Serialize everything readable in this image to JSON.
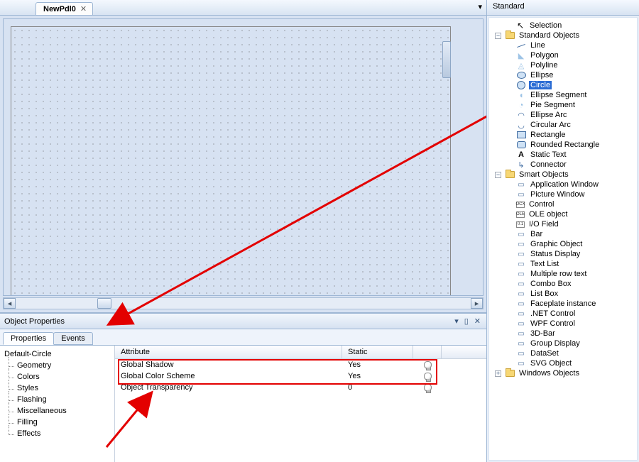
{
  "canvas_tab": "NewPdl0",
  "panel_title": "Object Properties",
  "tabs": {
    "properties": "Properties",
    "events": "Events"
  },
  "categories": {
    "root": "Default-Circle",
    "children": [
      "Geometry",
      "Colors",
      "Styles",
      "Flashing",
      "Miscellaneous",
      "Filling",
      "Effects"
    ]
  },
  "attr_headers": {
    "attribute": "Attribute",
    "static": "Static"
  },
  "attributes": [
    {
      "name": "Global Shadow",
      "static": "Yes"
    },
    {
      "name": "Global Color Scheme",
      "static": "Yes"
    },
    {
      "name": "Object Transparency",
      "static": "0"
    }
  ],
  "palette_title": "Standard",
  "tree": {
    "selection": "Selection",
    "std_objects": "Standard Objects",
    "std_children": [
      "Line",
      "Polygon",
      "Polyline",
      "Ellipse",
      "Circle",
      "Ellipse Segment",
      "Pie Segment",
      "Ellipse Arc",
      "Circular Arc",
      "Rectangle",
      "Rounded Rectangle",
      "Static Text",
      "Connector"
    ],
    "smart_objects": "Smart Objects",
    "smart_children": [
      "Application Window",
      "Picture Window",
      "Control",
      "OLE object",
      "I/O Field",
      "Bar",
      "Graphic Object",
      "Status Display",
      "Text List",
      "Multiple row text",
      "Combo Box",
      "List Box",
      "Faceplate instance",
      ".NET Control",
      "WPF Control",
      "3D-Bar",
      "Group Display",
      "DataSet",
      "SVG Object"
    ],
    "win_objects": "Windows Objects"
  },
  "selected_tree_item": "Circle"
}
